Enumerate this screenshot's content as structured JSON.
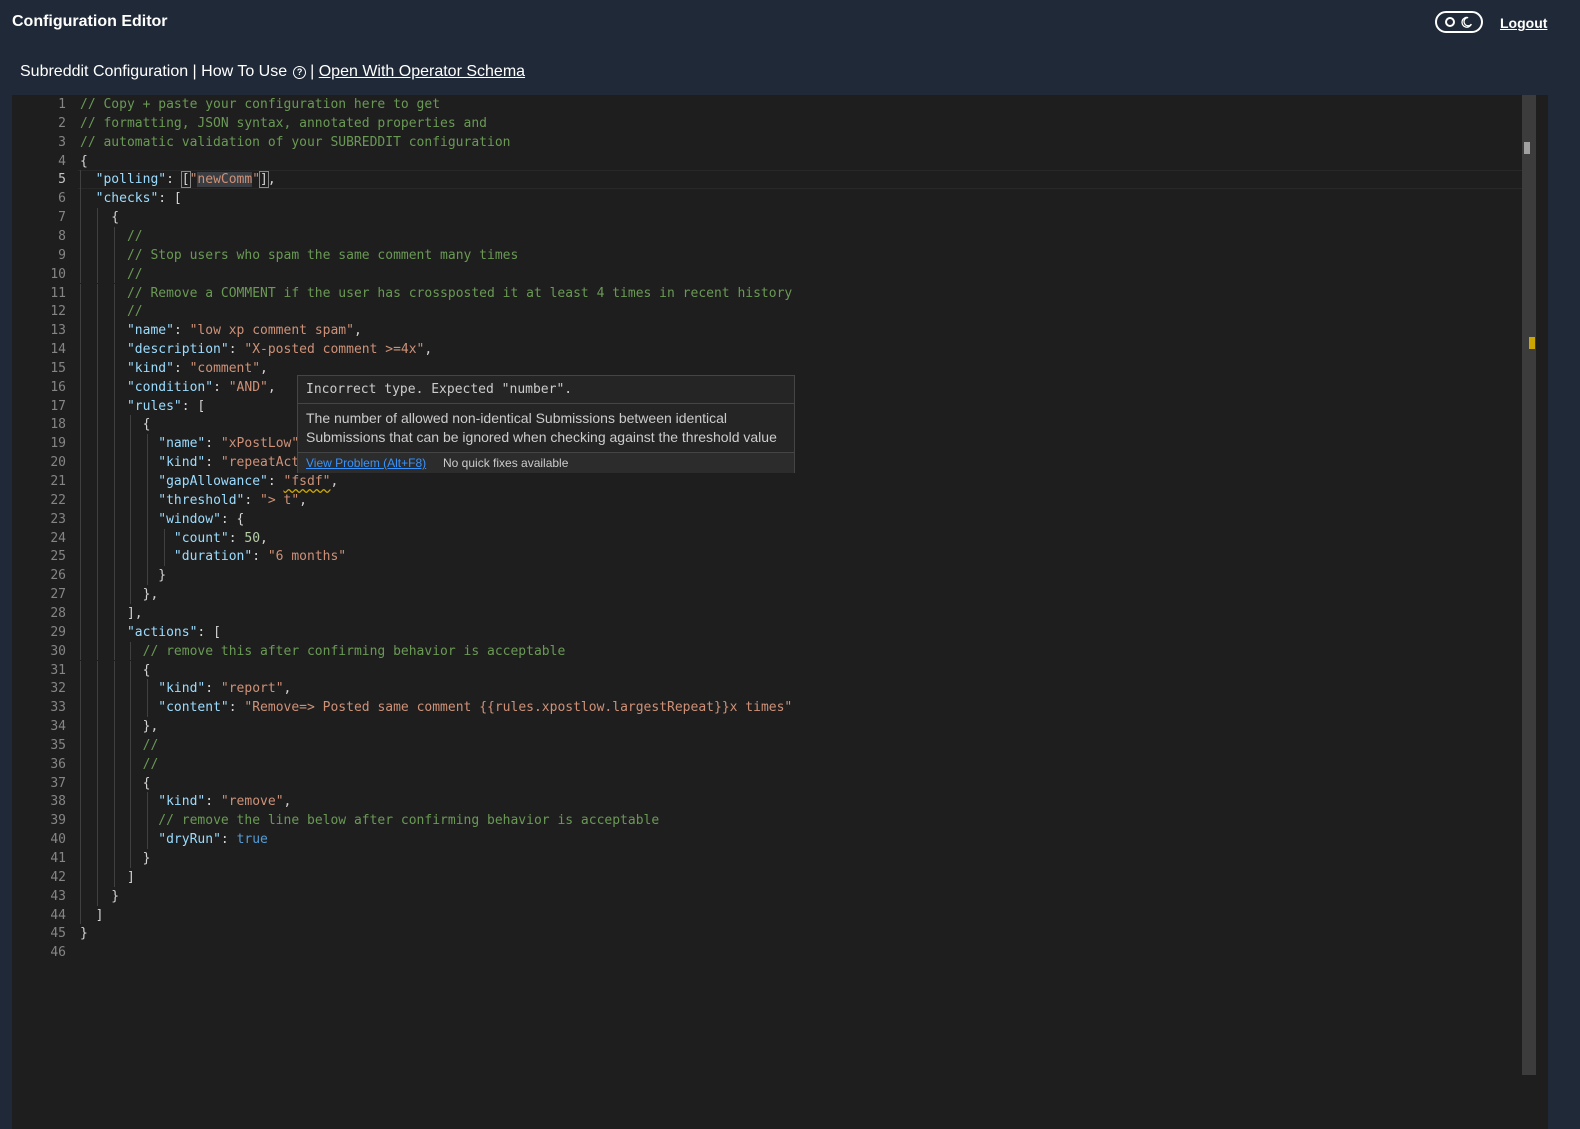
{
  "header": {
    "title": "Configuration Editor",
    "logout_label": "Logout",
    "toggle_icon": "moon-icon"
  },
  "subbar": {
    "config_label": "Subreddit Configuration | How To Use",
    "separator": " | ",
    "schema_link": "Open With Operator Schema",
    "help_icon": "question-circle-icon"
  },
  "editor": {
    "active_line": 5,
    "lines": [
      [
        [
          "c",
          "// Copy + paste your configuration here to get"
        ]
      ],
      [
        [
          "c",
          "// formatting, JSON syntax, annotated properties and"
        ]
      ],
      [
        [
          "c",
          "// automatic validation of your SUBREDDIT configuration"
        ]
      ],
      [
        [
          "p",
          "{"
        ]
      ],
      [
        [
          "p",
          "  "
        ],
        [
          "k",
          "\"polling\""
        ],
        [
          "p",
          ": "
        ],
        [
          "bm",
          "["
        ],
        [
          "s",
          "\""
        ],
        [
          "ss",
          "newComm"
        ],
        [
          "s",
          "\""
        ],
        [
          "bm",
          "]"
        ],
        [
          "p",
          ","
        ]
      ],
      [
        [
          "p",
          "  "
        ],
        [
          "k",
          "\"checks\""
        ],
        [
          "p",
          ": ["
        ]
      ],
      [
        [
          "p",
          "    {"
        ]
      ],
      [
        [
          "p",
          "      "
        ],
        [
          "c",
          "//"
        ]
      ],
      [
        [
          "p",
          "      "
        ],
        [
          "c",
          "// Stop users who spam the same comment many times"
        ]
      ],
      [
        [
          "p",
          "      "
        ],
        [
          "c",
          "//"
        ]
      ],
      [
        [
          "p",
          "      "
        ],
        [
          "c",
          "// Remove a COMMENT if the user has crossposted it at least 4 times in recent history"
        ]
      ],
      [
        [
          "p",
          "      "
        ],
        [
          "c",
          "//"
        ]
      ],
      [
        [
          "p",
          "      "
        ],
        [
          "k",
          "\"name\""
        ],
        [
          "p",
          ": "
        ],
        [
          "s",
          "\"low xp comment spam\""
        ],
        [
          "p",
          ","
        ]
      ],
      [
        [
          "p",
          "      "
        ],
        [
          "k",
          "\"description\""
        ],
        [
          "p",
          ": "
        ],
        [
          "s",
          "\"X-posted comment >=4x\""
        ],
        [
          "p",
          ","
        ]
      ],
      [
        [
          "p",
          "      "
        ],
        [
          "k",
          "\"kind\""
        ],
        [
          "p",
          ": "
        ],
        [
          "s",
          "\"comment\""
        ],
        [
          "p",
          ","
        ]
      ],
      [
        [
          "p",
          "      "
        ],
        [
          "k",
          "\"condition\""
        ],
        [
          "p",
          ": "
        ],
        [
          "s",
          "\"AND\""
        ],
        [
          "p",
          ","
        ]
      ],
      [
        [
          "p",
          "      "
        ],
        [
          "k",
          "\"rules\""
        ],
        [
          "p",
          ": ["
        ]
      ],
      [
        [
          "p",
          "        {"
        ]
      ],
      [
        [
          "p",
          "          "
        ],
        [
          "k",
          "\"name\""
        ],
        [
          "p",
          ": "
        ],
        [
          "s",
          "\"xPostLow\""
        ],
        [
          "p",
          ","
        ]
      ],
      [
        [
          "p",
          "          "
        ],
        [
          "k",
          "\"kind\""
        ],
        [
          "p",
          ": "
        ],
        [
          "s",
          "\"repeatActivity\""
        ],
        [
          "p",
          ","
        ]
      ],
      [
        [
          "p",
          "          "
        ],
        [
          "k",
          "\"gapAllowance\""
        ],
        [
          "p",
          ": "
        ],
        [
          "sq",
          "\"fsdf\""
        ],
        [
          "p",
          ","
        ]
      ],
      [
        [
          "p",
          "          "
        ],
        [
          "k",
          "\"threshold\""
        ],
        [
          "p",
          ": "
        ],
        [
          "s",
          "\"> t\""
        ],
        [
          "p",
          ","
        ]
      ],
      [
        [
          "p",
          "          "
        ],
        [
          "k",
          "\"window\""
        ],
        [
          "p",
          ": {"
        ]
      ],
      [
        [
          "p",
          "            "
        ],
        [
          "k",
          "\"count\""
        ],
        [
          "p",
          ": "
        ],
        [
          "n",
          "50"
        ],
        [
          "p",
          ","
        ]
      ],
      [
        [
          "p",
          "            "
        ],
        [
          "k",
          "\"duration\""
        ],
        [
          "p",
          ": "
        ],
        [
          "s",
          "\"6 months\""
        ]
      ],
      [
        [
          "p",
          "          }"
        ]
      ],
      [
        [
          "p",
          "        },"
        ]
      ],
      [
        [
          "p",
          "      ],"
        ]
      ],
      [
        [
          "p",
          "      "
        ],
        [
          "k",
          "\"actions\""
        ],
        [
          "p",
          ": ["
        ]
      ],
      [
        [
          "p",
          "        "
        ],
        [
          "c",
          "// remove this after confirming behavior is acceptable"
        ]
      ],
      [
        [
          "p",
          "        {"
        ]
      ],
      [
        [
          "p",
          "          "
        ],
        [
          "k",
          "\"kind\""
        ],
        [
          "p",
          ": "
        ],
        [
          "s",
          "\"report\""
        ],
        [
          "p",
          ","
        ]
      ],
      [
        [
          "p",
          "          "
        ],
        [
          "k",
          "\"content\""
        ],
        [
          "p",
          ": "
        ],
        [
          "s",
          "\"Remove=> Posted same comment {{rules.xpostlow.largestRepeat}}x times\""
        ]
      ],
      [
        [
          "p",
          "        },"
        ]
      ],
      [
        [
          "p",
          "        "
        ],
        [
          "c",
          "//"
        ]
      ],
      [
        [
          "p",
          "        "
        ],
        [
          "c",
          "//"
        ]
      ],
      [
        [
          "p",
          "        {"
        ]
      ],
      [
        [
          "p",
          "          "
        ],
        [
          "k",
          "\"kind\""
        ],
        [
          "p",
          ": "
        ],
        [
          "s",
          "\"remove\""
        ],
        [
          "p",
          ","
        ]
      ],
      [
        [
          "p",
          "          "
        ],
        [
          "c",
          "// remove the line below after confirming behavior is acceptable"
        ]
      ],
      [
        [
          "p",
          "          "
        ],
        [
          "k",
          "\"dryRun\""
        ],
        [
          "p",
          ": "
        ],
        [
          "b",
          "true"
        ]
      ],
      [
        [
          "p",
          "        }"
        ]
      ],
      [
        [
          "p",
          "      ]"
        ]
      ],
      [
        [
          "p",
          "    }"
        ]
      ],
      [
        [
          "p",
          "  ]"
        ]
      ],
      [
        [
          "p",
          "}"
        ]
      ],
      []
    ]
  },
  "hover": {
    "title": "Incorrect type. Expected \"number\".",
    "description": "The number of allowed non-identical Submissions between identical Submissions that can be ignored when checking against the threshold value",
    "view_problem": "View Problem (Alt+F8)",
    "no_fixes": "No quick fixes available"
  },
  "colors": {
    "page_bg": "#1f2937",
    "editor_bg": "#1e1e1e",
    "comment": "#6a9955",
    "key": "#9cdcfe",
    "string": "#ce9178",
    "number": "#b5cea8",
    "boolean": "#569cd6",
    "warning": "#cca700",
    "link": "#3794ff"
  }
}
